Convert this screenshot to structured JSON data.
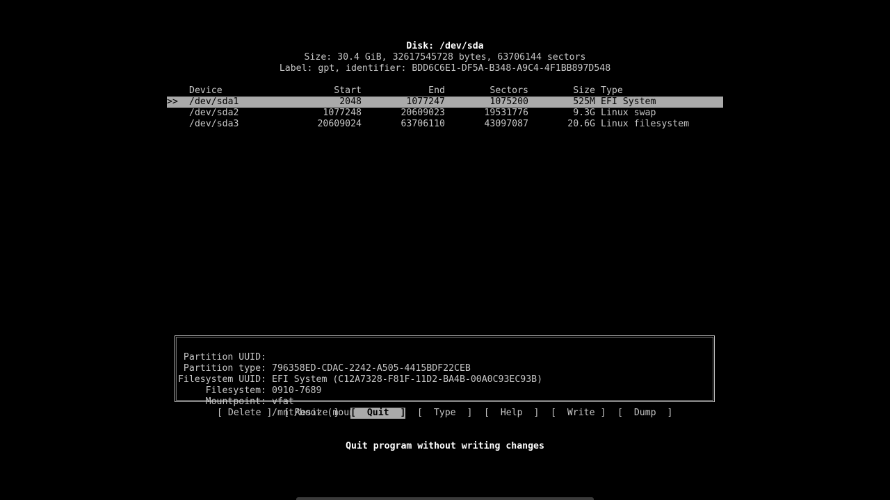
{
  "header": {
    "disk": "Disk: /dev/sda",
    "size": "Size: 30.4 GiB, 32617545728 bytes, 63706144 sectors",
    "label": "Label: gpt, identifier: BDD6C6E1-DF5A-B348-A9C4-4F1BB897D548"
  },
  "table": {
    "columns": {
      "device": "Device",
      "start": "Start",
      "end": "End",
      "sectors": "Sectors",
      "size": "Size",
      "type": "Type"
    },
    "selected_marker": ">>",
    "rows": [
      {
        "device": "/dev/sda1",
        "start": "2048",
        "end": "1077247",
        "sectors": "1075200",
        "size": "525M",
        "type": "EFI System"
      },
      {
        "device": "/dev/sda2",
        "start": "1077248",
        "end": "20609023",
        "sectors": "19531776",
        "size": "9.3G",
        "type": "Linux swap"
      },
      {
        "device": "/dev/sda3",
        "start": "20609024",
        "end": "63706110",
        "sectors": "43097087",
        "size": "20.6G",
        "type": "Linux filesystem"
      }
    ]
  },
  "info": {
    "partition_uuid_label": "Partition UUID:",
    "partition_uuid": "796358ED-CDAC-2242-A505-4415BDF22CEB",
    "partition_type_label": "Partition type:",
    "partition_type": "EFI System (C12A7328-F81F-11D2-BA4B-00A0C93EC93B)",
    "filesystem_uuid_label": "Filesystem UUID:",
    "filesystem_uuid": "0910-7689",
    "filesystem_label": "Filesystem:",
    "filesystem": "vfat",
    "mountpoint_label": "Mountpoint:",
    "mountpoint": "/mnt/boot (mounted)"
  },
  "menu": {
    "delete": "[ Delete ]",
    "resize": "[ Resize ]",
    "quit": "[  Quit  ]",
    "type": "[  Type  ]",
    "help": "[  Help  ]",
    "write": "[  Write ]",
    "dump": "[  Dump  ]"
  },
  "status": "Quit program without writing changes"
}
